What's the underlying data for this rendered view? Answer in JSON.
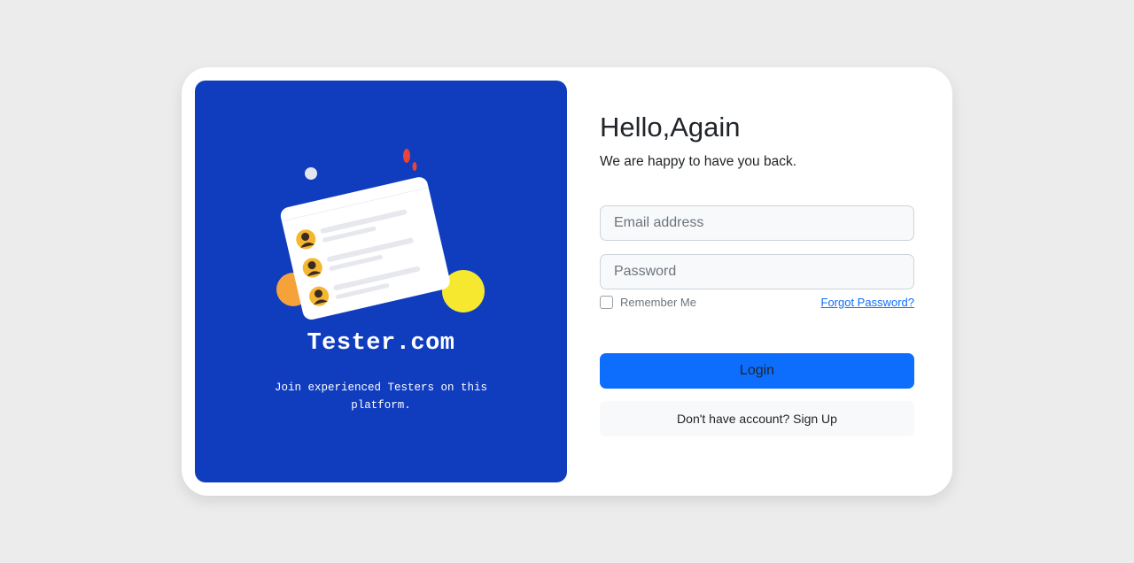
{
  "brand": {
    "name": "Tester.com",
    "tagline": "Join experienced Testers on this platform."
  },
  "login": {
    "title": "Hello,Again",
    "subtitle": "We are happy to have you back.",
    "email_placeholder": "Email address",
    "email_value": "",
    "password_placeholder": "Password",
    "password_value": "",
    "remember_label": "Remember Me",
    "remember_checked": false,
    "forgot_label": "Forgot Password?",
    "login_label": "Login",
    "signup_label": "Don't have account? Sign Up"
  },
  "colors": {
    "page_background": "#ececec",
    "brand_panel": "#103cbe",
    "primary_button": "#0d6efd",
    "link": "#0d6efd",
    "field_background": "#f8f9fa",
    "illustration_yellow": "#f5e82f",
    "illustration_orange": "#f6a23b",
    "illustration_red": "#e8443a"
  },
  "icons": {
    "illustration": "user-list-card-illustration",
    "avatar": "user-avatar-icon",
    "checkbox": "checkbox-icon"
  }
}
